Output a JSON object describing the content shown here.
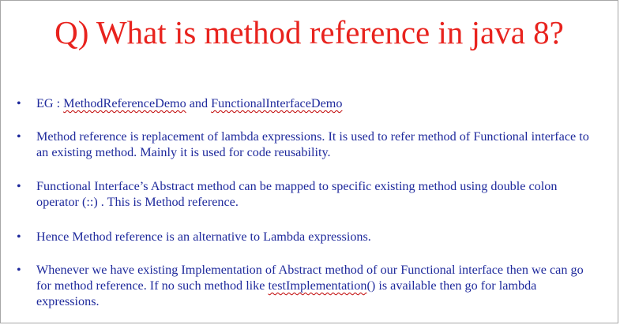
{
  "slide": {
    "title": "Q) What is method reference in java 8?",
    "bullets": {
      "eg": {
        "prefix": "EG : ",
        "link1": "MethodReferenceDemo",
        "middle": " and ",
        "link2": "FunctionalInterfaceDemo"
      },
      "b2": "Method reference is replacement of lambda expressions. It is used to refer method of Functional interface to an existing method. Mainly it is used for code reusability.",
      "b3": "Functional Interface’s Abstract method can be mapped to specific existing method using double colon operator (::) . This is Method reference.",
      "b4": "Hence Method reference is an alternative to Lambda expressions.",
      "b5": {
        "before": "Whenever we have existing Implementation of Abstract method of our Functional interface then we can go for method reference. If no such method like ",
        "code": "testImplementation",
        "after": "() is available then go for lambda expressions."
      },
      "bullet_symbol": "•"
    },
    "colors": {
      "title": "#e8231e",
      "body": "#1f2a9c",
      "spellcheck": "#c00000"
    }
  }
}
